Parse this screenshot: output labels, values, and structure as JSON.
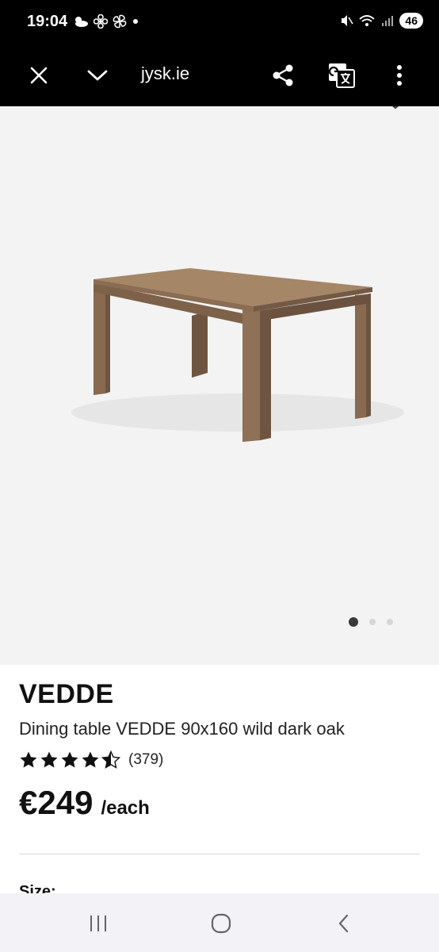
{
  "status_bar": {
    "time": "19:04",
    "battery": "46"
  },
  "toolbar": {
    "url": "jysk.ie"
  },
  "gallery": {
    "slide_count": 3,
    "active_index": 0
  },
  "product": {
    "brand": "VEDDE",
    "title": "Dining table VEDDE 90x160 wild dark oak",
    "rating": 4.5,
    "review_count": "(379)",
    "price": "€249",
    "unit": "/each",
    "size_label": "Size:"
  },
  "colors": {
    "toolbar_bg": "#000000",
    "hero_bg": "#f3f3f3",
    "wood": "#8b6c52"
  }
}
